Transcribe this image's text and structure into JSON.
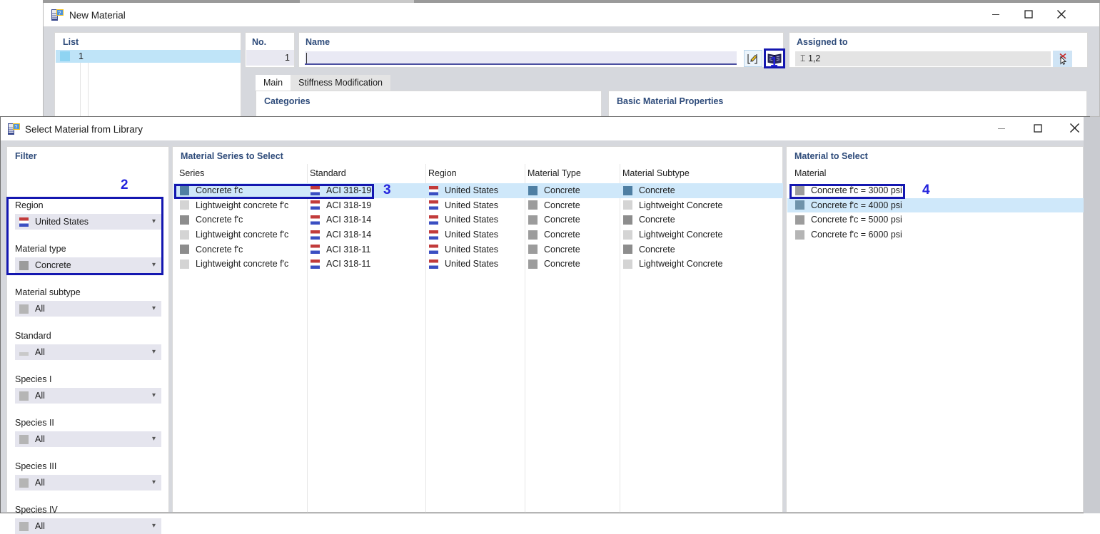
{
  "new_material_window": {
    "title": "New Material",
    "icon": "material-app-icon",
    "window_controls": {
      "minimize": "—",
      "maximize": "▢",
      "close": "✕"
    },
    "list_panel": {
      "header": "List",
      "rows": [
        {
          "label": "1"
        }
      ]
    },
    "no_panel": {
      "header": "No.",
      "value": "1"
    },
    "name_panel": {
      "header": "Name",
      "value": "",
      "placeholder": "",
      "edit_button_icon": "edit-pencil-icon",
      "library_button_icon": "open-book-icon"
    },
    "assigned_panel": {
      "header": "Assigned to",
      "value": "⌶ 1,2",
      "clear_button_icon": "delete-cursor-icon"
    },
    "tabs": [
      {
        "label": "Main",
        "active": true
      },
      {
        "label": "Stiffness Modification",
        "active": false
      }
    ],
    "categories_panel": {
      "header": "Categories"
    },
    "basic_properties_panel": {
      "header": "Basic Material Properties"
    }
  },
  "library_window": {
    "title": "Select Material from Library",
    "icon": "material-app-icon",
    "window_controls": {
      "minimize": "—",
      "maximize": "▢",
      "close": "✕"
    },
    "filter": {
      "header": "Filter",
      "fields": [
        {
          "label": "Region",
          "value": "United States",
          "swatch": "flag-us",
          "chevron": "chevron-down-icon"
        },
        {
          "label": "Material type",
          "value": "Concrete",
          "swatch": "#9c9c9c",
          "chevron": "chevron-down-icon"
        },
        {
          "label": "Material subtype",
          "value": "All",
          "swatch": "#b5b5b5",
          "chevron": "chevron-down-icon"
        },
        {
          "label": "Standard",
          "value": "All",
          "swatch": "#c9c9c9",
          "chevron": "chevron-down-icon"
        },
        {
          "label": "Species I",
          "value": "All",
          "swatch": "#b5b5b5",
          "chevron": "chevron-down-icon"
        },
        {
          "label": "Species II",
          "value": "All",
          "swatch": "#b5b5b5",
          "chevron": "chevron-down-icon"
        },
        {
          "label": "Species III",
          "value": "All",
          "swatch": "#b5b5b5",
          "chevron": "chevron-down-icon"
        },
        {
          "label": "Species IV",
          "value": "All",
          "swatch": "#b5b5b5",
          "chevron": "chevron-down-icon"
        }
      ]
    },
    "series_panel": {
      "header": "Material Series to Select",
      "columns": [
        "Series",
        "Standard",
        "Region",
        "Material Type",
        "Material Subtype"
      ],
      "rows": [
        {
          "series": "Concrete f'c",
          "standard": "ACI 318-19",
          "region": "United States",
          "type": "Concrete",
          "subtype": "Concrete",
          "selected": true,
          "sw_series": "#4f7fa3",
          "sw_sub": "#4f7fa3",
          "sw_type": "#4f7fa3"
        },
        {
          "series": "Lightweight concrete f'c",
          "standard": "ACI 318-19",
          "region": "United States",
          "type": "Concrete",
          "subtype": "Lightweight Concrete",
          "selected": false,
          "sw_series": "#d4d4d4",
          "sw_sub": "#d4d4d4",
          "sw_type": "#9c9c9c"
        },
        {
          "series": "Concrete f'c",
          "standard": "ACI 318-14",
          "region": "United States",
          "type": "Concrete",
          "subtype": "Concrete",
          "selected": false,
          "sw_series": "#8d8d8d",
          "sw_sub": "#8d8d8d",
          "sw_type": "#9c9c9c"
        },
        {
          "series": "Lightweight concrete f'c",
          "standard": "ACI 318-14",
          "region": "United States",
          "type": "Concrete",
          "subtype": "Lightweight Concrete",
          "selected": false,
          "sw_series": "#d4d4d4",
          "sw_sub": "#d4d4d4",
          "sw_type": "#9c9c9c"
        },
        {
          "series": "Concrete f'c",
          "standard": "ACI 318-11",
          "region": "United States",
          "type": "Concrete",
          "subtype": "Concrete",
          "selected": false,
          "sw_series": "#8d8d8d",
          "sw_sub": "#8d8d8d",
          "sw_type": "#9c9c9c"
        },
        {
          "series": "Lightweight concrete f'c",
          "standard": "ACI 318-11",
          "region": "United States",
          "type": "Concrete",
          "subtype": "Lightweight Concrete",
          "selected": false,
          "sw_series": "#d4d4d4",
          "sw_sub": "#d4d4d4",
          "sw_type": "#9c9c9c"
        }
      ]
    },
    "material_panel": {
      "header": "Material to Select",
      "column": "Material",
      "rows": [
        {
          "label": "Concrete f'c = 3000 psi",
          "selected": false,
          "swatch": "#9c9c9c"
        },
        {
          "label": "Concrete f'c = 4000 psi",
          "selected": true,
          "swatch": "#6f93ab"
        },
        {
          "label": "Concrete f'c = 5000 psi",
          "selected": false,
          "swatch": "#9c9c9c"
        },
        {
          "label": "Concrete f'c = 6000 psi",
          "selected": false,
          "swatch": "#b5b5b5"
        }
      ]
    }
  },
  "annotations": [
    {
      "id": "1",
      "target": "library-button"
    },
    {
      "id": "2",
      "target": "filter-region-materialtype-group"
    },
    {
      "id": "3",
      "target": "selected-series-row"
    },
    {
      "id": "4",
      "target": "selected-material-row"
    }
  ],
  "colors": {
    "annotation_blue": "#1417b0",
    "annotation_text_blue": "#2424dd",
    "selection_blue": "#cfe8fa",
    "list_selection": "#bfe4f8",
    "panel_header_blue": "#2e4b7a",
    "dialog_bg": "#d6d8dd"
  }
}
